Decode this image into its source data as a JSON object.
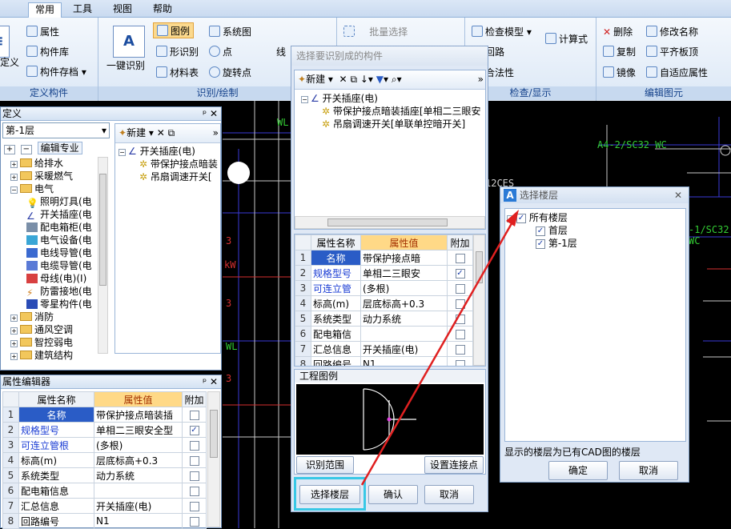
{
  "menu": {
    "tabs": [
      "常用",
      "工具",
      "视图",
      "帮助"
    ]
  },
  "ribbon": {
    "g1": {
      "items": [
        "属性",
        "构件库",
        "构件存档"
      ],
      "partial": "定义",
      "label": "定义构件"
    },
    "g2": {
      "big": "一键识别",
      "tuli": "图例",
      "xingshibie": "形识别",
      "cailiao": "材料表",
      "xitongtu": "系统图",
      "dian": "点",
      "xuanzhuandian": "旋转点",
      "xian": "线",
      "label": "识别/绘制"
    },
    "g3": {
      "piliang": "批量选择"
    },
    "g4": {
      "jiancha": "检查模型",
      "huilu": "回路",
      "hefaxing": "合法性",
      "jisuan": "计算式",
      "label": "检查/显示"
    },
    "g5": {
      "shanchu": "删除",
      "fuzhi": "复制",
      "jingxiang": "镜像",
      "xiugai": "修改名称",
      "pingqi": "平齐板顶",
      "zishiying": "自适应属性",
      "label": "编辑图元"
    }
  },
  "left": {
    "title": "定义",
    "floor": "第-1层",
    "edit_pro": "编辑专业",
    "tree": [
      "给排水",
      "采暖燃气",
      "电气",
      "照明灯具(电",
      "开关插座(电",
      "配电箱柜(电",
      "电气设备(电",
      "电线导管(电",
      "电缆导管(电",
      "母线(电)(I)",
      "防雷接地(电",
      "零星构件(电",
      "消防",
      "通风空调",
      "智控弱电",
      "建筑结构"
    ],
    "new_label": "新建",
    "sub_tree": [
      "开关插座(电)",
      "带保护接点暗装",
      "吊扇调速开关["
    ]
  },
  "prop_editor": {
    "title": "属性编辑器",
    "headers": [
      "属性名称",
      "属性值",
      "附加"
    ],
    "rows": [
      {
        "n": "1",
        "name": "名称",
        "val": "带保护接点暗装插",
        "chk": ""
      },
      {
        "n": "2",
        "name": "规格型号",
        "val": "单相二三眼安全型",
        "chk": "✓"
      },
      {
        "n": "3",
        "name": "可连立管根",
        "val": "(多根)",
        "chk": ""
      },
      {
        "n": "4",
        "name": "标高(m)",
        "val": "层底标高+0.3",
        "chk": ""
      },
      {
        "n": "5",
        "name": "系统类型",
        "val": "动力系统",
        "chk": ""
      },
      {
        "n": "6",
        "name": "配电箱信息",
        "val": "",
        "chk": ""
      },
      {
        "n": "7",
        "name": "汇总信息",
        "val": "开关插座(电)",
        "chk": ""
      },
      {
        "n": "8",
        "name": "回路编号",
        "val": "N1",
        "chk": ""
      }
    ]
  },
  "dialog": {
    "title": "选择要识别成的构件",
    "new_label": "新建",
    "tree": [
      "开关插座(电)",
      "带保护接点暗装插座[单相二三眼安",
      "吊扇调速开关[单联单控暗开关]"
    ],
    "headers": [
      "属性名称",
      "属性值",
      "附加"
    ],
    "rows": [
      {
        "n": "1",
        "name": "名称",
        "val": "带保护接点暗",
        "chk": ""
      },
      {
        "n": "2",
        "name": "规格型号",
        "val": "单相二三眼安",
        "chk": "✓"
      },
      {
        "n": "3",
        "name": "可连立管",
        "val": "(多根)",
        "chk": ""
      },
      {
        "n": "4",
        "name": "标高(m)",
        "val": "层底标高+0.3",
        "chk": ""
      },
      {
        "n": "5",
        "name": "系统类型",
        "val": "动力系统",
        "chk": ""
      },
      {
        "n": "6",
        "name": "配电箱信",
        "val": "",
        "chk": ""
      },
      {
        "n": "7",
        "name": "汇总信息",
        "val": "开关插座(电)",
        "chk": ""
      },
      {
        "n": "8",
        "name": "回路编号",
        "val": "N1",
        "chk": ""
      }
    ],
    "legend": "工程图例",
    "btn_range": "识别范围",
    "btn_connect": "设置连接点",
    "btn_floor": "选择楼层",
    "btn_ok": "确认",
    "btn_cancel": "取消"
  },
  "floor_dialog": {
    "title": "选择楼层",
    "tree": [
      "所有楼层",
      "首层",
      "第-1层"
    ],
    "note": "显示的楼层为已有CAD图的楼层",
    "ok": "确定",
    "cancel": "取消"
  },
  "cad": {
    "t1": "WL",
    "t2": "A4-2/SC32 WC",
    "t3": "-1/SC32 WC",
    "t4": "3",
    "t5": "kW",
    "t6": "3",
    "t7": "WL",
    "t8": "3",
    "t9": "12CES"
  },
  "colors": {
    "accent": "#2a5cc6",
    "highlight": "#39c8e6",
    "arrow": "#e02020"
  }
}
